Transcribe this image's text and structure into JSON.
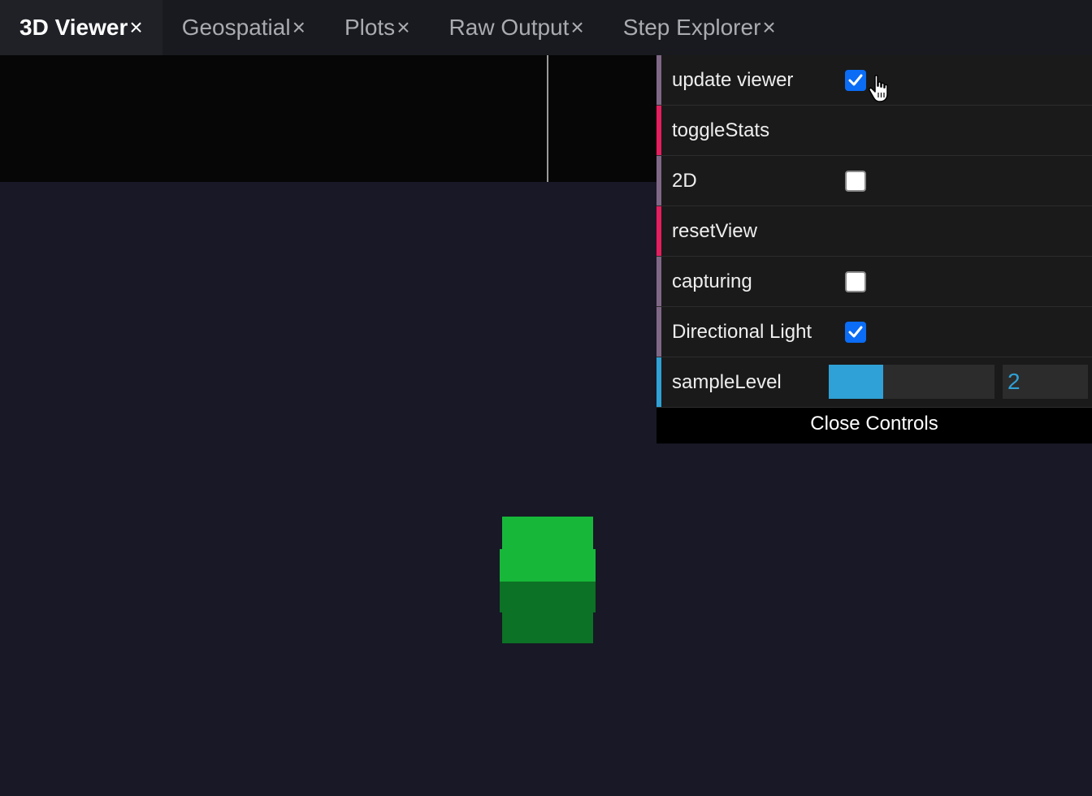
{
  "tabs": [
    {
      "label": "3D Viewer",
      "active": true
    },
    {
      "label": "Geospatial",
      "active": false
    },
    {
      "label": "Plots",
      "active": false
    },
    {
      "label": "Raw Output",
      "active": false
    },
    {
      "label": "Step Explorer",
      "active": false
    }
  ],
  "tab_close_glyph": "×",
  "controls": {
    "update_viewer": {
      "label": "update viewer",
      "checked": true
    },
    "toggle_stats": {
      "label": "toggleStats"
    },
    "two_d": {
      "label": "2D",
      "checked": false
    },
    "reset_view": {
      "label": "resetView"
    },
    "capturing": {
      "label": "capturing",
      "checked": false
    },
    "directional_light": {
      "label": "Directional Light",
      "checked": true
    },
    "sample_level": {
      "label": "sampleLevel",
      "value": "2",
      "fill_fraction": 0.33
    },
    "close_label": "Close Controls"
  },
  "colors": {
    "viewport_bg": "#181826",
    "cube_light": "#17b83a",
    "cube_dark": "#0c7225",
    "bool_accent": "#806787",
    "function_accent": "#e61d5f",
    "number_accent": "#2fa1d6",
    "checkbox_checked": "#0b6cf5"
  }
}
